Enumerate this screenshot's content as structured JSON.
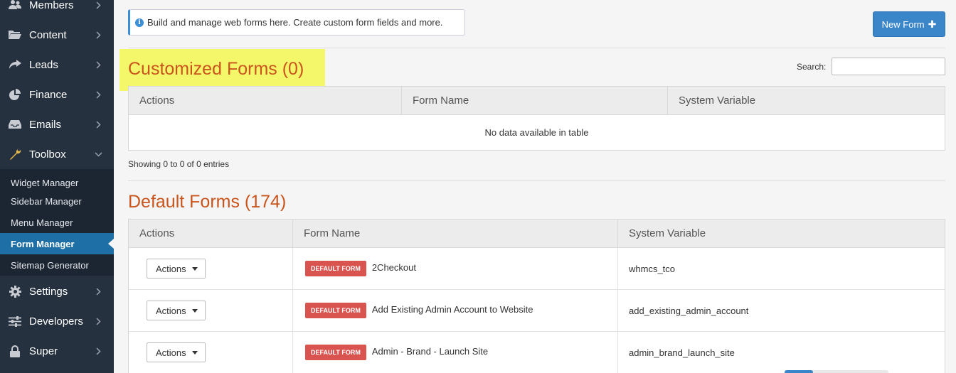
{
  "sidebar": {
    "items": [
      {
        "label": "Members",
        "icon": "users-icon"
      },
      {
        "label": "Content",
        "icon": "folder-icon"
      },
      {
        "label": "Leads",
        "icon": "share-icon"
      },
      {
        "label": "Finance",
        "icon": "pie-chart-icon"
      },
      {
        "label": "Emails",
        "icon": "inbox-icon"
      },
      {
        "label": "Toolbox",
        "icon": "wrench-icon"
      },
      {
        "label": "Settings",
        "icon": "gear-icon"
      },
      {
        "label": "Developers",
        "icon": "sliders-icon"
      },
      {
        "label": "Super",
        "icon": "lock-icon"
      }
    ],
    "toolbox_sub": [
      {
        "label": "Widget Manager"
      },
      {
        "label": "Sidebar Manager"
      },
      {
        "label": "Menu Manager"
      },
      {
        "label": "Form Manager",
        "active": true
      },
      {
        "label": "Sitemap Generator"
      }
    ]
  },
  "alert": {
    "text": "Build and manage web forms here. Create custom form fields and more."
  },
  "new_form_button": {
    "label": "New Form"
  },
  "custom_section": {
    "title": "Customized Forms (0)",
    "search_label": "Search:",
    "columns": [
      "Actions",
      "Form Name",
      "System Variable"
    ],
    "empty_text": "No data available in table",
    "showing": "Showing 0 to 0 of 0 entries"
  },
  "default_section": {
    "title": "Default Forms (174)",
    "columns": [
      "Actions",
      "Form Name",
      "System Variable"
    ],
    "actions_label": "Actions",
    "badge_label": "DEFAULT FORM",
    "rows": [
      {
        "name": "2Checkout",
        "variable": "whmcs_tco"
      },
      {
        "name": "Add Existing Admin Account to Website",
        "variable": "add_existing_admin_account"
      },
      {
        "name": "Admin - Brand - Launch Site",
        "variable": "admin_brand_launch_site"
      }
    ]
  },
  "colors": {
    "sidebar_bg": "#25313e",
    "active_item": "#1d6fa5",
    "accent_blue": "#3b85c9",
    "heading_orange": "#c9551c",
    "badge_red": "#d9534f",
    "highlight_yellow": "#f4f76a"
  }
}
